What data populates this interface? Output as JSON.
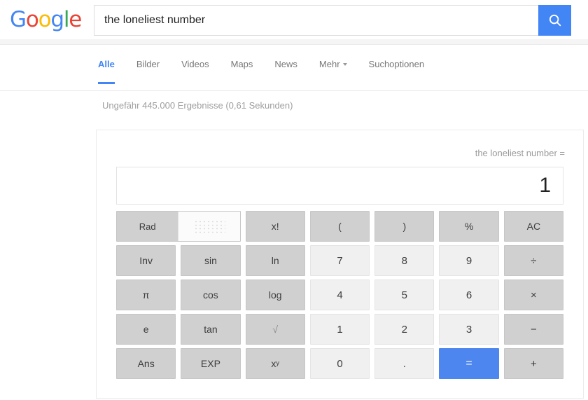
{
  "browser": {
    "logo_letters": [
      {
        "ch": "G",
        "color": "#4285F4"
      },
      {
        "ch": "o",
        "color": "#EA4335"
      },
      {
        "ch": "o",
        "color": "#FBBC05"
      },
      {
        "ch": "g",
        "color": "#4285F4"
      },
      {
        "ch": "l",
        "color": "#34A853"
      },
      {
        "ch": "e",
        "color": "#EA4335"
      }
    ],
    "logo_text": "Google"
  },
  "search": {
    "query": "the loneliest number",
    "placeholder": "",
    "button_icon": "search-icon",
    "button_color": "#4285F4"
  },
  "nav": {
    "items": [
      {
        "label": "Alle",
        "active": true
      },
      {
        "label": "Bilder",
        "active": false
      },
      {
        "label": "Videos",
        "active": false
      },
      {
        "label": "Maps",
        "active": false
      },
      {
        "label": "News",
        "active": false
      },
      {
        "label": "Mehr",
        "active": false,
        "caret": true
      },
      {
        "label": "Suchoptionen",
        "active": false
      }
    ],
    "accent_color": "#4285F4"
  },
  "results": {
    "stats": "Ungefähr 445.000 Ergebnisse (0,61 Sekunden)"
  },
  "calculator": {
    "query_echo": "the loneliest number =",
    "display_value": "1",
    "mode_toggle": {
      "active_label": "Rad",
      "inactive_label": "",
      "inactive_icon": "dot-grid-icon"
    },
    "keys": [
      {
        "label": "x!",
        "kind": "fn",
        "name": "factorial"
      },
      {
        "label": "(",
        "kind": "fn",
        "name": "open-paren"
      },
      {
        "label": ")",
        "kind": "fn",
        "name": "close-paren"
      },
      {
        "label": "%",
        "kind": "fn",
        "name": "percent"
      },
      {
        "label": "AC",
        "kind": "fn",
        "name": "all-clear"
      },
      {
        "label": "Inv",
        "kind": "fn",
        "name": "inverse"
      },
      {
        "label": "sin",
        "kind": "fn",
        "name": "sin"
      },
      {
        "label": "ln",
        "kind": "fn",
        "name": "ln"
      },
      {
        "label": "7",
        "kind": "num",
        "name": "digit-7"
      },
      {
        "label": "8",
        "kind": "num",
        "name": "digit-8"
      },
      {
        "label": "9",
        "kind": "num",
        "name": "digit-9"
      },
      {
        "label": "÷",
        "kind": "op",
        "name": "divide"
      },
      {
        "label": "π",
        "kind": "fn",
        "name": "pi"
      },
      {
        "label": "cos",
        "kind": "fn",
        "name": "cos"
      },
      {
        "label": "log",
        "kind": "fn",
        "name": "log"
      },
      {
        "label": "4",
        "kind": "num",
        "name": "digit-4"
      },
      {
        "label": "5",
        "kind": "num",
        "name": "digit-5"
      },
      {
        "label": "6",
        "kind": "num",
        "name": "digit-6"
      },
      {
        "label": "×",
        "kind": "op",
        "name": "multiply"
      },
      {
        "label": "e",
        "kind": "fn",
        "name": "euler"
      },
      {
        "label": "tan",
        "kind": "fn",
        "name": "tan"
      },
      {
        "label": "√",
        "kind": "dim",
        "name": "square-root"
      },
      {
        "label": "1",
        "kind": "num",
        "name": "digit-1"
      },
      {
        "label": "2",
        "kind": "num",
        "name": "digit-2"
      },
      {
        "label": "3",
        "kind": "num",
        "name": "digit-3"
      },
      {
        "label": "−",
        "kind": "op",
        "name": "minus"
      },
      {
        "label": "Ans",
        "kind": "fn",
        "name": "answer"
      },
      {
        "label": "EXP",
        "kind": "fn",
        "name": "exponent"
      },
      {
        "label": "xy",
        "kind": "sup",
        "name": "power",
        "base": "x",
        "exp": "y"
      },
      {
        "label": "0",
        "kind": "num",
        "name": "digit-0"
      },
      {
        "label": ".",
        "kind": "num",
        "name": "decimal-point"
      },
      {
        "label": "=",
        "kind": "eq",
        "name": "equals"
      },
      {
        "label": "+",
        "kind": "op",
        "name": "plus"
      }
    ],
    "equals_color": "#4d86ee"
  }
}
